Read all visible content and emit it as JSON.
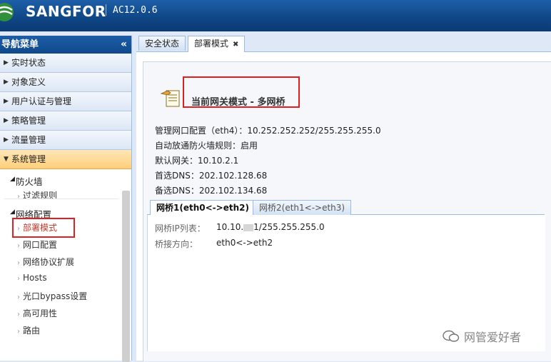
{
  "header": {
    "brand": "SANGFOR",
    "version": "AC12.0.6"
  },
  "sidebar": {
    "title": "导航菜单",
    "sections": [
      {
        "label": "实时状态"
      },
      {
        "label": "对象定义"
      },
      {
        "label": "用户认证与管理"
      },
      {
        "label": "策略管理"
      },
      {
        "label": "流量管理"
      },
      {
        "label": "系统管理"
      }
    ],
    "tree": {
      "firewall": {
        "label": "防火墙",
        "items": [
          "过滤规则"
        ]
      },
      "network": {
        "label": "网络配置",
        "items": [
          "部署模式",
          "网口配置",
          "网络协议扩展",
          "Hosts",
          "光口bypass设置",
          "高可用性",
          "路由"
        ]
      }
    }
  },
  "tabs": [
    {
      "label": "安全状态"
    },
    {
      "label": "部署模式"
    }
  ],
  "main": {
    "mode_title": "当前网关模式 - 多网桥",
    "info": {
      "mgmt_label": "管理网口配置（eth4）：",
      "mgmt_value": "10.252.252.252/255.255.255.0",
      "fw_label": "自动放通防火墙规则：",
      "fw_value": "启用",
      "gw_label": "默认网关：",
      "gw_value": "10.10.2.1",
      "dns1_label": "首选DNS：",
      "dns1_value": "202.102.128.68",
      "dns2_label": "备选DNS：",
      "dns2_value": "202.102.134.68"
    },
    "subtabs": [
      {
        "label": "网桥1(eth0<->eth2)"
      },
      {
        "label": "网桥2(eth1<->eth3)"
      }
    ],
    "bridge": {
      "ip_label": "网桥IP列表：",
      "ip_prefix": "10.10.",
      "ip_suffix": "1/255.255.255.0",
      "dir_label": "桥接方向：",
      "dir_value": "eth0<->eth2"
    }
  },
  "watermark": "网管爱好者",
  "colors": {
    "header": "#0f4584",
    "active_section": "#ffcf7a",
    "highlight": "#e02020"
  }
}
